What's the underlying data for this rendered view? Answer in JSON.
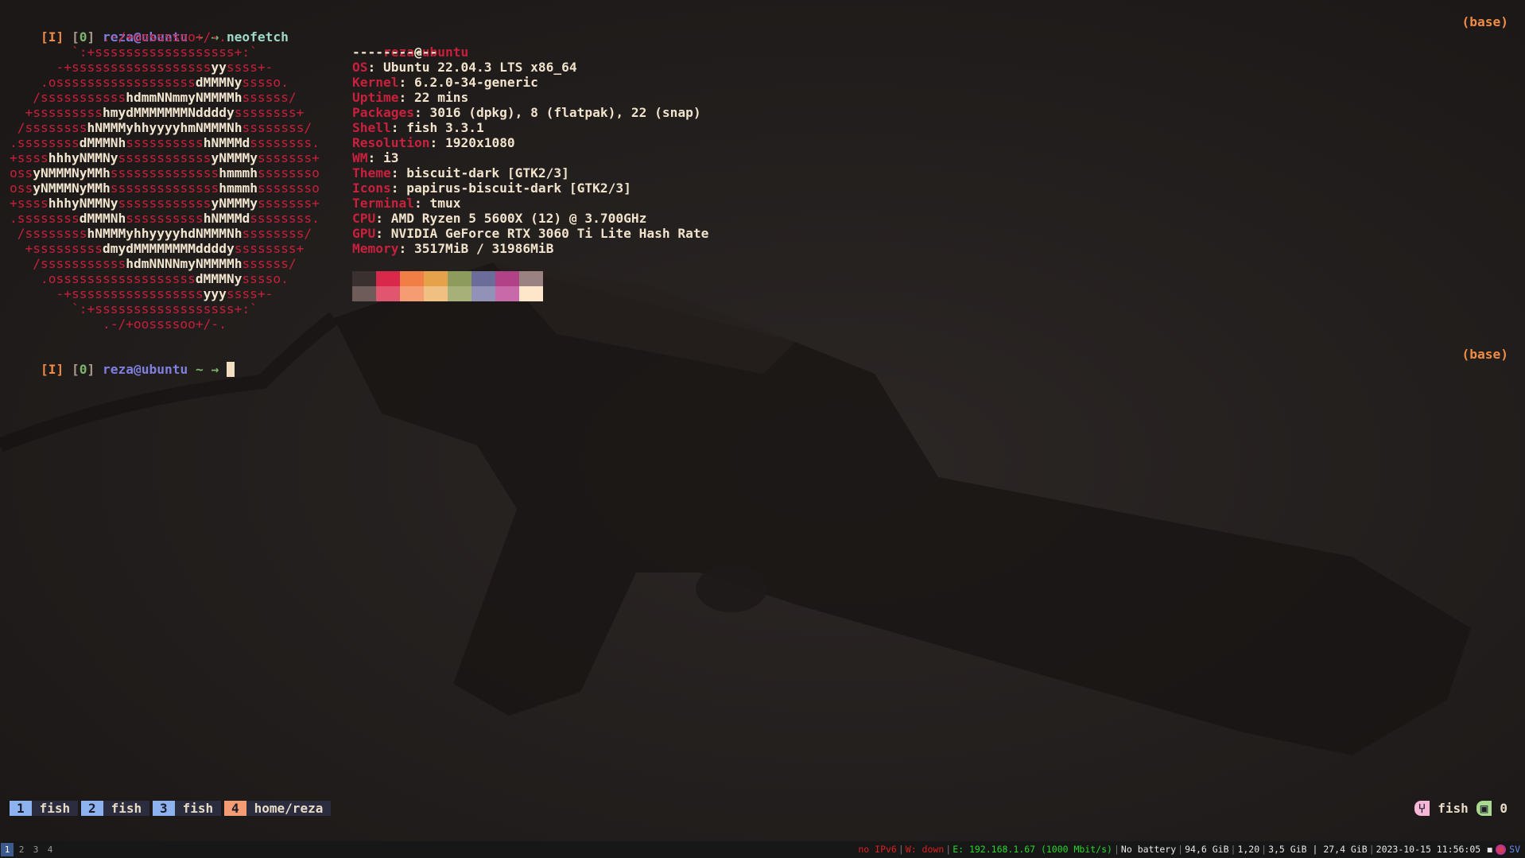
{
  "prompt": {
    "mode": "[I]",
    "jobs_open": "[",
    "jobs": "0",
    "jobs_close": "]",
    "user_host": "reza@ubuntu",
    "cwd": "~",
    "arrow": "→",
    "command": "neofetch",
    "env": "(base)"
  },
  "logo_lines": [
    "            .-/+oossssoo+/-.",
    "        `:+ssssssssssssssssss+:`",
    "      -+ssssssssssssssssssyyssss+-",
    "    .ossssssssssssssssssdMMMNysssso.",
    "   /ssssssssssshdmmNNmmyNMMMMhssssss/",
    "  +ssssssssshmydMMMMMMMNddddyssssssss+",
    " /sssssssshNMMMyhhyyyyhmNMMMNhssssssss/",
    ".ssssssssdMMMNhsssssssssshNMMMdssssssss.",
    "+sssshhhyNMMNyssssssssssssyNMMMysssssss+",
    "ossyNMMMNyMMhsssssssssssssshmmmhssssssso",
    "ossyNMMMNyMMhsssssssssssssshmmmhssssssso",
    "+sssshhhyNMMNyssssssssssssyNMMMysssssss+",
    ".ssssssssdMMMNhsssssssssshNMMMdssssssss.",
    " /sssssssshNMMMyhhyyyyhdNMMMNhssssssss/",
    "  +sssssssssdmydMMMMMMMMddddyssssssss+",
    "   /ssssssssssshdmNNNNmyNMMMMhssssss/",
    "    .ossssssssssssssssssdMMMNysssso.",
    "      -+sssssssssssssssssyyyssss+-",
    "        `:+ssssssssssssssssss+:`",
    "            .-/+oossssoo+/-."
  ],
  "info": {
    "user": "reza",
    "at": "@",
    "host": "ubuntu",
    "divider": "-----------",
    "rows": [
      {
        "key": "OS",
        "value": "Ubuntu 22.04.3 LTS x86_64"
      },
      {
        "key": "Kernel",
        "value": "6.2.0-34-generic"
      },
      {
        "key": "Uptime",
        "value": "22 mins"
      },
      {
        "key": "Packages",
        "value": "3016 (dpkg), 8 (flatpak), 22 (snap)"
      },
      {
        "key": "Shell",
        "value": "fish 3.3.1"
      },
      {
        "key": "Resolution",
        "value": "1920x1080"
      },
      {
        "key": "WM",
        "value": "i3"
      },
      {
        "key": "Theme",
        "value": "biscuit-dark [GTK2/3]"
      },
      {
        "key": "Icons",
        "value": "papirus-biscuit-dark [GTK2/3]"
      },
      {
        "key": "Terminal",
        "value": "tmux"
      },
      {
        "key": "CPU",
        "value": "AMD Ryzen 5 5600X (12) @ 3.700GHz"
      },
      {
        "key": "GPU",
        "value": "NVIDIA GeForce RTX 3060 Ti Lite Hash Rate"
      },
      {
        "key": "Memory",
        "value": "3517MiB / 31986MiB"
      }
    ],
    "palette_row1": [
      "#3a3030",
      "#d8294a",
      "#f07e45",
      "#e6a14b",
      "#8d9c5c",
      "#6c6c9a",
      "#b04287",
      "#9a8281"
    ],
    "palette_row2": [
      "#6e5c59",
      "#e0566f",
      "#f59c73",
      "#efc081",
      "#a7b079",
      "#9292b8",
      "#c86aaa",
      "#fde6c9"
    ]
  },
  "tmux": {
    "windows": [
      {
        "num": "1",
        "name": "fish",
        "color": "#8cb3f0"
      },
      {
        "num": "2",
        "name": "fish",
        "color": "#8cb3f0"
      },
      {
        "num": "3",
        "name": "fish",
        "color": "#8cb3f0"
      },
      {
        "num": "4",
        "name": "home/reza",
        "color": "#f59c73"
      }
    ],
    "right_name": "fish",
    "right_count": "0"
  },
  "i3bar": {
    "workspaces": [
      "1",
      "2",
      "3",
      "4"
    ],
    "ipv6": "no IPv6",
    "wifi": "W: down",
    "eth": "E: 192.168.1.67 (1000 Mbit/s)",
    "battery": "No battery",
    "disk": "94,6 GiB",
    "load": "1,20",
    "mem": "3,5 GiB | 27,4 GiB",
    "datetime": "2023-10-15 11:56:05",
    "tray_text": "SV"
  }
}
